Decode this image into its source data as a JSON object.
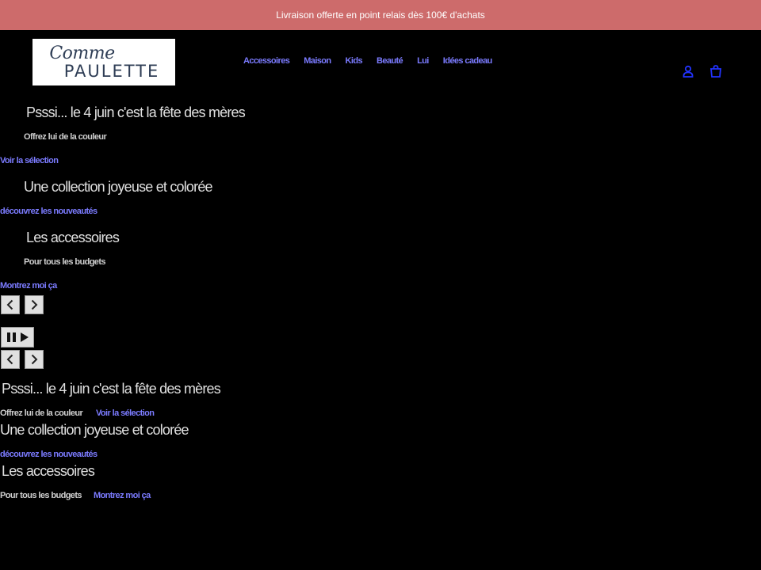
{
  "announcement": {
    "text": "Livraison offerte en point relais dès 100€ d'achats"
  },
  "logo": {
    "line1": "Comme",
    "line2": "PAULETTE"
  },
  "nav": [
    {
      "label": "Accessoires"
    },
    {
      "label": "Maison"
    },
    {
      "label": "Kids"
    },
    {
      "label": "Beauté"
    },
    {
      "label": "Lui"
    },
    {
      "label": "Idées cadeau"
    }
  ],
  "header_icons": {
    "account": "account-icon",
    "cart": "cart-icon"
  },
  "slides": [
    {
      "title": "Psssi... le 4 juin c'est la fête des mères",
      "subtitle": "Offrez lui de la couleur",
      "link": "Voir la sélection"
    },
    {
      "title": "Une collection joyeuse et colorée",
      "subtitle": "",
      "link": "découvrez les nouveautés"
    },
    {
      "title": "Les accessoires",
      "subtitle": "Pour tous les budgets",
      "link": "Montrez moi ça"
    }
  ],
  "controls": {
    "prev": "chevron-left-icon",
    "next": "chevron-right-icon",
    "pause": "pause-icon",
    "play": "play-icon"
  },
  "colors": {
    "announcement_bg": "#cd6b6b",
    "link": "#7b7bff",
    "background": "#000000"
  }
}
